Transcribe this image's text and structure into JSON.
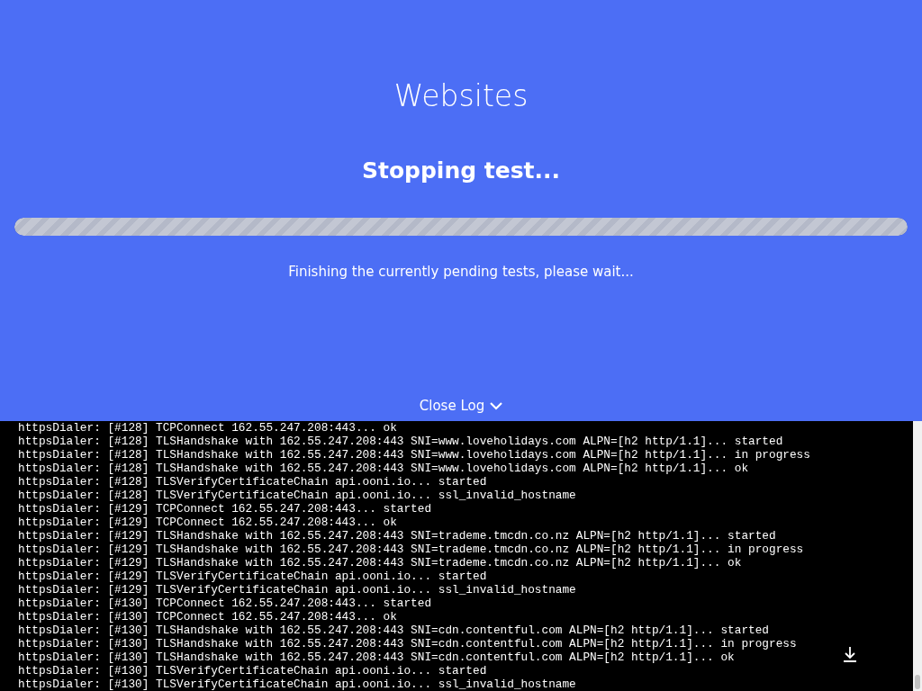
{
  "title": "Websites",
  "status": "Stopping test...",
  "progress": {
    "level": 1
  },
  "message": "Finishing the currently pending tests, please wait...",
  "log_toggle": {
    "label": "Close Log",
    "expanded": true
  },
  "log_lines": [
    "httpsDialer: [#128] TCPConnect 162.55.247.208:443... ok",
    "httpsDialer: [#128] TLSHandshake with 162.55.247.208:443 SNI=www.loveholidays.com ALPN=[h2 http/1.1]... started",
    "httpsDialer: [#128] TLSHandshake with 162.55.247.208:443 SNI=www.loveholidays.com ALPN=[h2 http/1.1]... in progress",
    "httpsDialer: [#128] TLSHandshake with 162.55.247.208:443 SNI=www.loveholidays.com ALPN=[h2 http/1.1]... ok",
    "httpsDialer: [#128] TLSVerifyCertificateChain api.ooni.io... started",
    "httpsDialer: [#128] TLSVerifyCertificateChain api.ooni.io... ssl_invalid_hostname",
    "httpsDialer: [#129] TCPConnect 162.55.247.208:443... started",
    "httpsDialer: [#129] TCPConnect 162.55.247.208:443... ok",
    "httpsDialer: [#129] TLSHandshake with 162.55.247.208:443 SNI=trademe.tmcdn.co.nz ALPN=[h2 http/1.1]... started",
    "httpsDialer: [#129] TLSHandshake with 162.55.247.208:443 SNI=trademe.tmcdn.co.nz ALPN=[h2 http/1.1]... in progress",
    "httpsDialer: [#129] TLSHandshake with 162.55.247.208:443 SNI=trademe.tmcdn.co.nz ALPN=[h2 http/1.1]... ok",
    "httpsDialer: [#129] TLSVerifyCertificateChain api.ooni.io... started",
    "httpsDialer: [#129] TLSVerifyCertificateChain api.ooni.io... ssl_invalid_hostname",
    "httpsDialer: [#130] TCPConnect 162.55.247.208:443... started",
    "httpsDialer: [#130] TCPConnect 162.55.247.208:443... ok",
    "httpsDialer: [#130] TLSHandshake with 162.55.247.208:443 SNI=cdn.contentful.com ALPN=[h2 http/1.1]... started",
    "httpsDialer: [#130] TLSHandshake with 162.55.247.208:443 SNI=cdn.contentful.com ALPN=[h2 http/1.1]... in progress",
    "httpsDialer: [#130] TLSHandshake with 162.55.247.208:443 SNI=cdn.contentful.com ALPN=[h2 http/1.1]... ok",
    "httpsDialer: [#130] TLSVerifyCertificateChain api.ooni.io... started",
    "httpsDialer: [#130] TLSVerifyCertificateChain api.ooni.io... ssl_invalid_hostname"
  ]
}
